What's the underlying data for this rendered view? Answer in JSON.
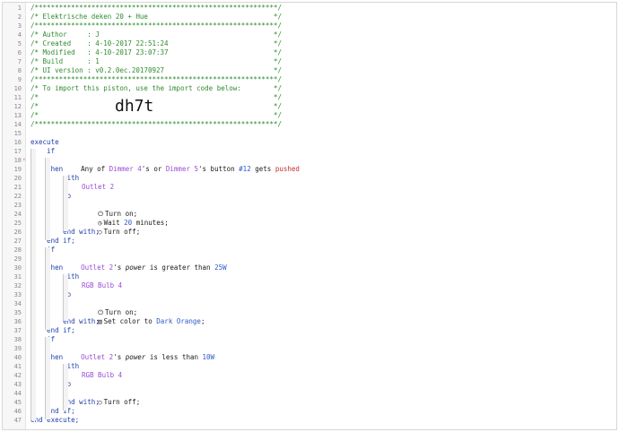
{
  "lines": [
    {
      "n": "1",
      "t": "/************************************************************/",
      "cls": "comment"
    },
    {
      "n": "2",
      "t": "/* Elektrische deken 20 + Hue                               */",
      "cls": "comment"
    },
    {
      "n": "3",
      "t": "/************************************************************/",
      "cls": "comment"
    },
    {
      "n": "4",
      "t": "/* Author     : J                                           */",
      "cls": "comment"
    },
    {
      "n": "5",
      "t": "/* Created    : 4-10-2017 22:51:24                          */",
      "cls": "comment"
    },
    {
      "n": "6",
      "t": "/* Modified   : 4-10-2017 23:07:37                          */",
      "cls": "comment"
    },
    {
      "n": "7",
      "t": "/* Build      : 1                                           */",
      "cls": "comment"
    },
    {
      "n": "8",
      "t": "/* UI version : v0.2.0ec.20170927                           */",
      "cls": "comment"
    },
    {
      "n": "9",
      "t": "/************************************************************/",
      "cls": "comment"
    },
    {
      "n": "10",
      "t": "/* To import this piston, use the import code below:        */",
      "cls": "comment"
    },
    {
      "n": "11",
      "t": "/*                                                          */",
      "cls": "comment"
    },
    {
      "n": "12",
      "t": "/*                                                          */",
      "cls": "comment"
    },
    {
      "n": "13",
      "t": "/*                                                          */",
      "cls": "comment"
    },
    {
      "n": "14",
      "t": "/************************************************************/",
      "cls": "comment"
    },
    {
      "n": "15",
      "t": ""
    },
    {
      "n": "16",
      "t": "execute",
      "cls": "kw"
    },
    {
      "n": "17",
      "t": "    if",
      "cls": "kw"
    },
    {
      "n": "18",
      "t": ""
    },
    {
      "n": "19",
      "t": "    then",
      "cls": "kw"
    },
    {
      "n": "20",
      "t": "        with",
      "cls": "kw"
    },
    {
      "n": "21",
      "t": ""
    },
    {
      "n": "22",
      "t": "        do",
      "cls": "kw"
    },
    {
      "n": "23",
      "t": ""
    },
    {
      "n": "24",
      "t": ""
    },
    {
      "n": "25",
      "t": ""
    },
    {
      "n": "26",
      "t": "        end with;",
      "cls": "kw"
    },
    {
      "n": "27",
      "t": "    end if;",
      "cls": "kw"
    },
    {
      "n": "28",
      "t": "    if",
      "cls": "kw"
    },
    {
      "n": "29",
      "t": ""
    },
    {
      "n": "30",
      "t": "    then",
      "cls": "kw"
    },
    {
      "n": "31",
      "t": "        with",
      "cls": "kw"
    },
    {
      "n": "32",
      "t": ""
    },
    {
      "n": "33",
      "t": "        do",
      "cls": "kw"
    },
    {
      "n": "34",
      "t": ""
    },
    {
      "n": "35",
      "t": ""
    },
    {
      "n": "36",
      "t": "        end with;",
      "cls": "kw"
    },
    {
      "n": "37",
      "t": "    end if;",
      "cls": "kw"
    },
    {
      "n": "38",
      "t": "    if",
      "cls": "kw"
    },
    {
      "n": "39",
      "t": ""
    },
    {
      "n": "40",
      "t": "    then",
      "cls": "kw"
    },
    {
      "n": "41",
      "t": "        with",
      "cls": "kw"
    },
    {
      "n": "42",
      "t": ""
    },
    {
      "n": "43",
      "t": "        do",
      "cls": "kw"
    },
    {
      "n": "44",
      "t": ""
    },
    {
      "n": "45",
      "t": "        end with;",
      "cls": "kw"
    },
    {
      "n": "46",
      "t": "    end if;",
      "cls": "kw"
    },
    {
      "n": "47",
      "t": "end execute;",
      "cls": "kw"
    }
  ],
  "import_code": "dh7t",
  "condition1": {
    "pre": "Any of ",
    "d1": "Dimmer 4",
    "mid1": "'s or ",
    "d2": "Dimmer 5",
    "mid2": "'s button ",
    "num": "#12",
    "mid3": " gets ",
    "evt": "pushed"
  },
  "dev_outlet2": "Outlet 2",
  "act_turn_on": "Turn on;",
  "act_wait_pre": "Wait ",
  "act_wait_num": "20",
  "act_wait_post": " minutes;",
  "act_turn_off": "Turn off;",
  "condition2": {
    "dev": "Outlet 2",
    "mid": "'s ",
    "attr": "power",
    "cmp": " is greater than ",
    "val": "25W"
  },
  "dev_bulb": "RGB Bulb 4",
  "act_set_color_pre": "Set color to ",
  "act_set_color_val": "Dark Orange",
  "act_set_color_post": ";",
  "condition3": {
    "dev": "Outlet 2",
    "mid": "'s ",
    "attr": "power",
    "cmp": " is less than ",
    "val": "10W"
  },
  "icons": {
    "power": "power-icon",
    "hourglass": "timer-icon",
    "circle": "circle-icon",
    "palette": "color-icon",
    "condition_marker": "condition-marker-icon"
  },
  "colors": {
    "comment": "#2e8b2e",
    "keyword": "#1e3fa8",
    "device": "#9a4ad8",
    "value": "#2e59c9",
    "event": "#c62d2d"
  }
}
